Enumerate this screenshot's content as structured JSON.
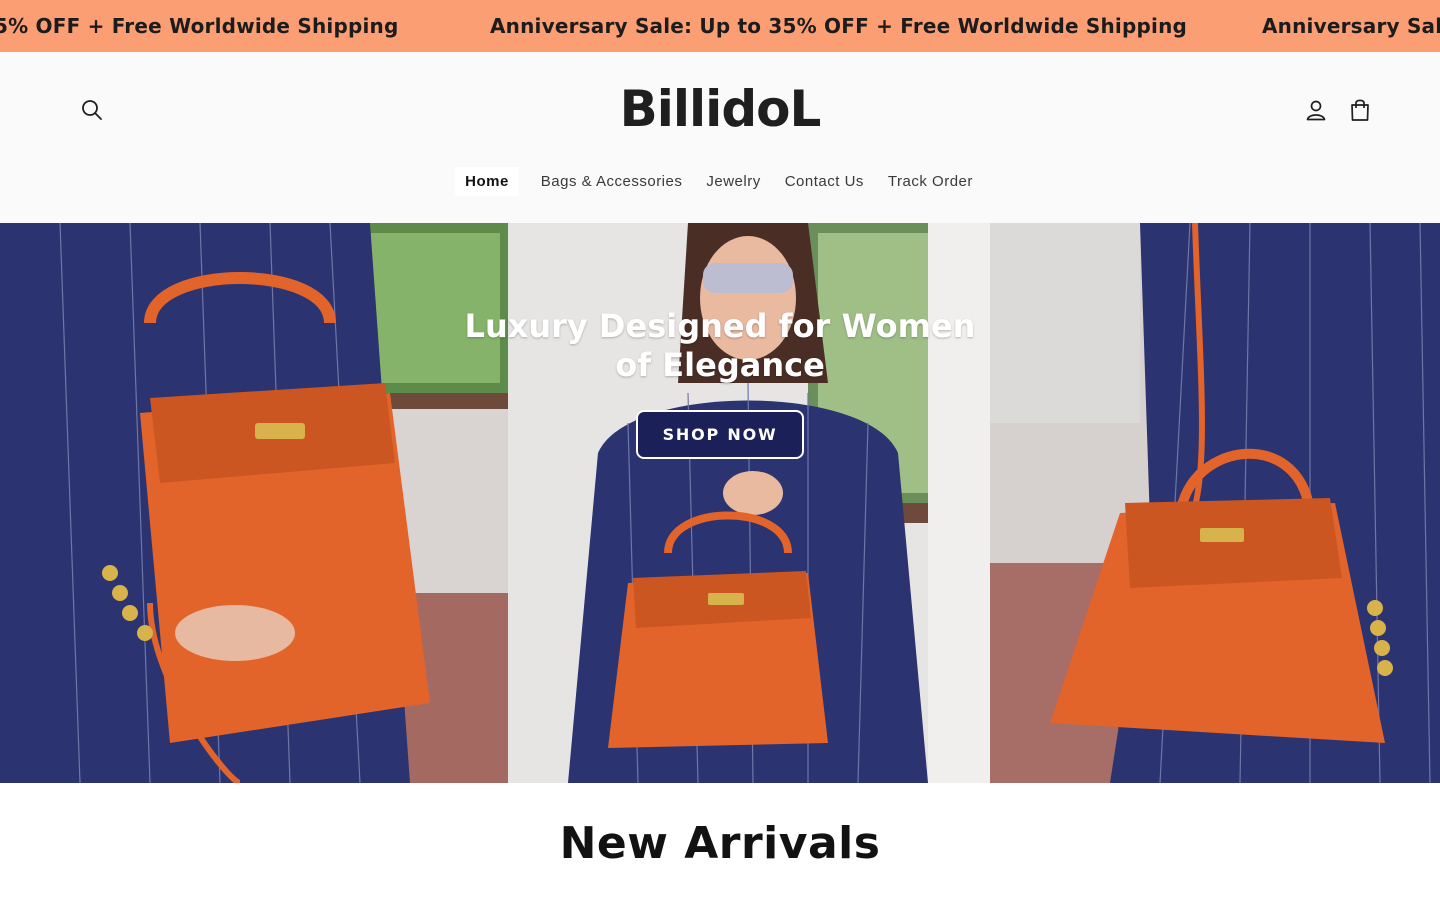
{
  "announcement": {
    "text_partial": "5% OFF + Free Worldwide Shipping",
    "text": "Anniversary Sale: Up to 35% OFF + Free Worldwide Shipping",
    "text_cut": "Anniversary Sale",
    "background": "#fc9e74"
  },
  "header": {
    "logo": "BillidoL",
    "icons": {
      "search": "search-icon",
      "account": "account-icon",
      "cart": "cart-icon"
    },
    "nav": [
      {
        "label": "Home",
        "active": true
      },
      {
        "label": "Bags & Accessories",
        "active": false
      },
      {
        "label": "Jewelry",
        "active": false
      },
      {
        "label": "Contact Us",
        "active": false
      },
      {
        "label": "Track Order",
        "active": false
      }
    ]
  },
  "hero": {
    "heading": "Luxury Designed for Women of Elegance",
    "button": "SHOP NOW",
    "button_color": "#1b2158",
    "bag_color": "#e2642a",
    "suit_color": "#2b3470"
  },
  "new_arrivals": {
    "title": "New Arrivals"
  }
}
